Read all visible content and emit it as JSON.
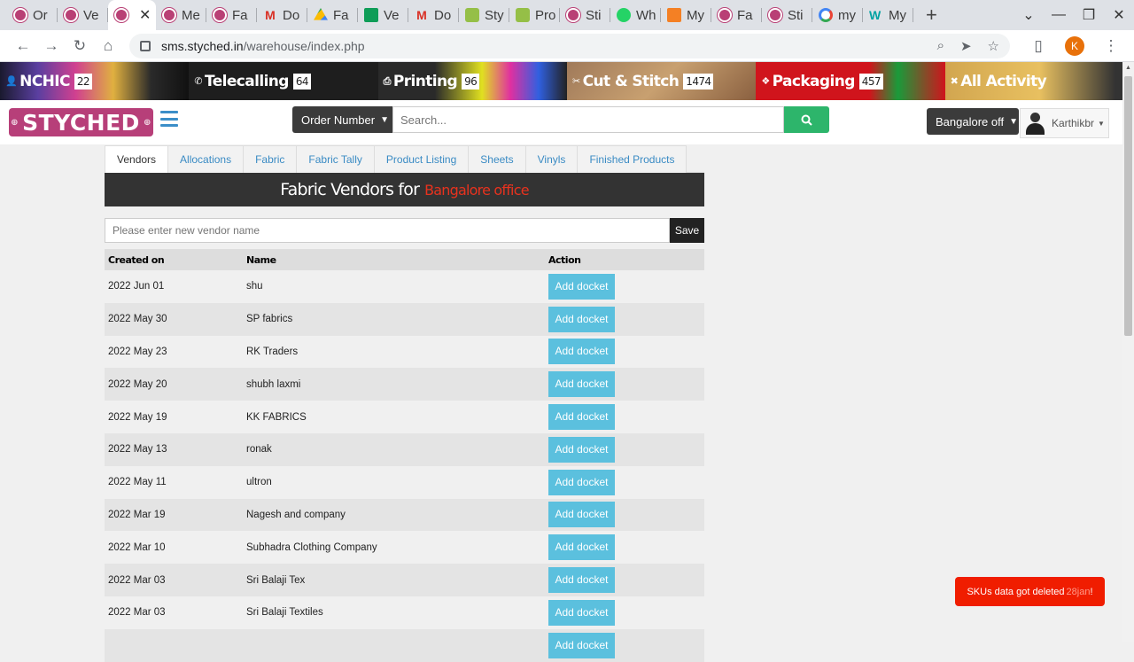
{
  "browser": {
    "tabs": [
      {
        "label": "Or",
        "favicon": "styched"
      },
      {
        "label": "Ve",
        "favicon": "styched"
      },
      {
        "label": "",
        "favicon": "styched",
        "active": true
      },
      {
        "label": "Me",
        "favicon": "styched"
      },
      {
        "label": "Fa",
        "favicon": "styched"
      },
      {
        "label": "Do",
        "favicon": "gmail"
      },
      {
        "label": "Fa",
        "favicon": "drive"
      },
      {
        "label": "Ve",
        "favicon": "sheets"
      },
      {
        "label": "Do",
        "favicon": "gmail"
      },
      {
        "label": "Sty",
        "favicon": "shopify"
      },
      {
        "label": "Pro",
        "favicon": "shopify"
      },
      {
        "label": "Sti",
        "favicon": "styched"
      },
      {
        "label": "Wh",
        "favicon": "whatsapp"
      },
      {
        "label": "My",
        "favicon": "stack"
      },
      {
        "label": "Fa",
        "favicon": "styched"
      },
      {
        "label": "Sti",
        "favicon": "styched"
      },
      {
        "label": "my",
        "favicon": "google"
      },
      {
        "label": "My",
        "favicon": "wix"
      }
    ],
    "url_host": "sms.styched.in",
    "url_path": "/warehouse/index.php",
    "profile_initial": "K"
  },
  "banner": [
    {
      "label": "NCHIC",
      "count": "22"
    },
    {
      "label": "Telecalling",
      "count": "64"
    },
    {
      "label": "Printing",
      "count": "96"
    },
    {
      "label": "Cut & Stitch",
      "count": "1474"
    },
    {
      "label": "Packaging",
      "count": "457"
    },
    {
      "label": "All Activity",
      "count": ""
    }
  ],
  "header": {
    "logo": "STYCHED",
    "search_type": "Order Number",
    "search_placeholder": "Search...",
    "office": "Bangalore off",
    "user": "Karthikbr"
  },
  "nav_tabs": [
    "Vendors",
    "Allocations",
    "Fabric",
    "Fabric Tally",
    "Product Listing",
    "Sheets",
    "Vinyls",
    "Finished Products"
  ],
  "vendors": {
    "title": "Fabric Vendors for",
    "office": "Bangalore office",
    "input_placeholder": "Please enter new vendor name",
    "save_label": "Save",
    "columns": [
      "Created on",
      "Name",
      "Action"
    ],
    "action_label": "Add docket",
    "rows": [
      {
        "date": "2022 Jun 01",
        "name": "shu"
      },
      {
        "date": "2022 May 30",
        "name": "SP fabrics"
      },
      {
        "date": "2022 May 23",
        "name": "RK Traders"
      },
      {
        "date": "2022 May 20",
        "name": "shubh laxmi"
      },
      {
        "date": "2022 May 19",
        "name": "KK FABRICS"
      },
      {
        "date": "2022 May 13",
        "name": "ronak"
      },
      {
        "date": "2022 May 11",
        "name": "ultron"
      },
      {
        "date": "2022 Mar 19",
        "name": "Nagesh and company"
      },
      {
        "date": "2022 Mar 10",
        "name": "Subhadra Clothing Company"
      },
      {
        "date": "2022 Mar 03",
        "name": "Sri Balaji Tex"
      },
      {
        "date": "2022 Mar 03",
        "name": "Sri Balaji Textiles"
      },
      {
        "date": "",
        "name": ""
      }
    ]
  },
  "toast": {
    "text": "SKUs data got deleted",
    "highlight": "28jan",
    "suffix": "!"
  },
  "colors": {
    "brand": "#b73f79",
    "accent": "#3a8bc4",
    "docket": "#5bc0de",
    "search": "#2db56b",
    "toast": "#f01d00",
    "office_highlight": "#e8321e"
  }
}
